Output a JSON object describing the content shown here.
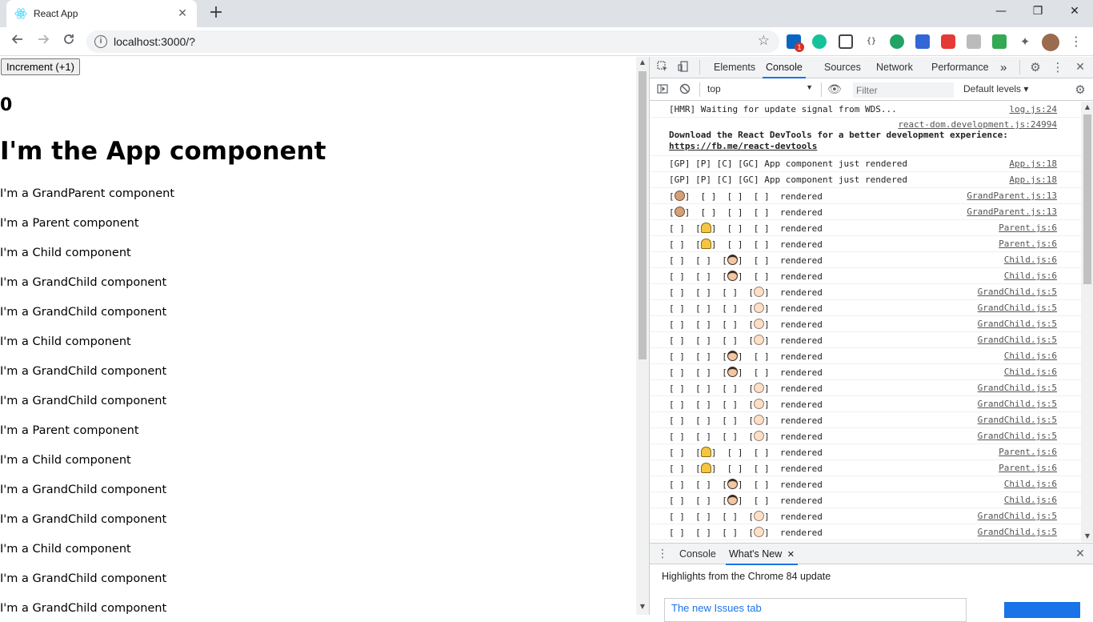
{
  "browser": {
    "tab_title": "React App",
    "tab_close": "✕",
    "new_tab": "+",
    "url": "localhost:3000/?",
    "window_controls": [
      "—",
      "❐",
      "✕"
    ],
    "extension_badge": "1"
  },
  "page": {
    "increment_button": "Increment (+1)",
    "counter_value": "0",
    "app_heading": "I'm the App component",
    "component_lines": [
      "I'm a GrandParent component",
      "I'm a Parent component",
      "I'm a Child component",
      "I'm a GrandChild component",
      "I'm a GrandChild component",
      "I'm a Child component",
      "I'm a GrandChild component",
      "I'm a GrandChild component",
      "I'm a Parent component",
      "I'm a Child component",
      "I'm a GrandChild component",
      "I'm a GrandChild component",
      "I'm a Child component",
      "I'm a GrandChild component",
      "I'm a GrandChild component"
    ]
  },
  "devtools": {
    "tabs": [
      "Elements",
      "Console",
      "Sources",
      "Network",
      "Performance"
    ],
    "active_tab": "Console",
    "more_tabs": "»",
    "context": "top",
    "filter_placeholder": "Filter",
    "levels": "Default levels ▾",
    "logs": [
      {
        "type": "text",
        "msg": "[HMR] Waiting for update signal from WDS...",
        "src": "log.js:24"
      },
      {
        "type": "tall",
        "msg": "Download the React DevTools for a better development experience: ",
        "link": "https://fb.me/react-devtools",
        "src": "react-dom.development.js:24994"
      },
      {
        "type": "text",
        "msg": "[GP] [P] [C] [GC] App component just rendered",
        "src": "App.js:18"
      },
      {
        "type": "text",
        "msg": "[GP] [P] [C] [GC] App component just rendered",
        "src": "App.js:18"
      },
      {
        "type": "emoji",
        "slot": 0,
        "kind": "gp",
        "src": "GrandParent.js:13"
      },
      {
        "type": "emoji",
        "slot": 0,
        "kind": "gp",
        "src": "GrandParent.js:13"
      },
      {
        "type": "emoji",
        "slot": 1,
        "kind": "p",
        "src": "Parent.js:6"
      },
      {
        "type": "emoji",
        "slot": 1,
        "kind": "p",
        "src": "Parent.js:6"
      },
      {
        "type": "emoji",
        "slot": 2,
        "kind": "c",
        "src": "Child.js:6"
      },
      {
        "type": "emoji",
        "slot": 2,
        "kind": "c",
        "src": "Child.js:6"
      },
      {
        "type": "emoji",
        "slot": 3,
        "kind": "gc",
        "src": "GrandChild.js:5"
      },
      {
        "type": "emoji",
        "slot": 3,
        "kind": "gc",
        "src": "GrandChild.js:5"
      },
      {
        "type": "emoji",
        "slot": 3,
        "kind": "gc",
        "src": "GrandChild.js:5"
      },
      {
        "type": "emoji",
        "slot": 3,
        "kind": "gc",
        "src": "GrandChild.js:5"
      },
      {
        "type": "emoji",
        "slot": 2,
        "kind": "c",
        "src": "Child.js:6"
      },
      {
        "type": "emoji",
        "slot": 2,
        "kind": "c",
        "src": "Child.js:6"
      },
      {
        "type": "emoji",
        "slot": 3,
        "kind": "gc",
        "src": "GrandChild.js:5"
      },
      {
        "type": "emoji",
        "slot": 3,
        "kind": "gc",
        "src": "GrandChild.js:5"
      },
      {
        "type": "emoji",
        "slot": 3,
        "kind": "gc",
        "src": "GrandChild.js:5"
      },
      {
        "type": "emoji",
        "slot": 3,
        "kind": "gc",
        "src": "GrandChild.js:5"
      },
      {
        "type": "emoji",
        "slot": 1,
        "kind": "p",
        "src": "Parent.js:6"
      },
      {
        "type": "emoji",
        "slot": 1,
        "kind": "p",
        "src": "Parent.js:6"
      },
      {
        "type": "emoji",
        "slot": 2,
        "kind": "c",
        "src": "Child.js:6"
      },
      {
        "type": "emoji",
        "slot": 2,
        "kind": "c",
        "src": "Child.js:6"
      },
      {
        "type": "emoji",
        "slot": 3,
        "kind": "gc",
        "src": "GrandChild.js:5"
      },
      {
        "type": "emoji",
        "slot": 3,
        "kind": "gc",
        "src": "GrandChild.js:5"
      }
    ],
    "rendered_word": "rendered",
    "drawer_tabs": [
      "Console",
      "What's New"
    ],
    "drawer_active": "What's New",
    "whats_new_heading": "Highlights from the Chrome 84 update",
    "issues_card_title": "The new Issues tab"
  },
  "colors": {
    "accent": "#1a73e8",
    "tabbar": "#dee1e6"
  }
}
